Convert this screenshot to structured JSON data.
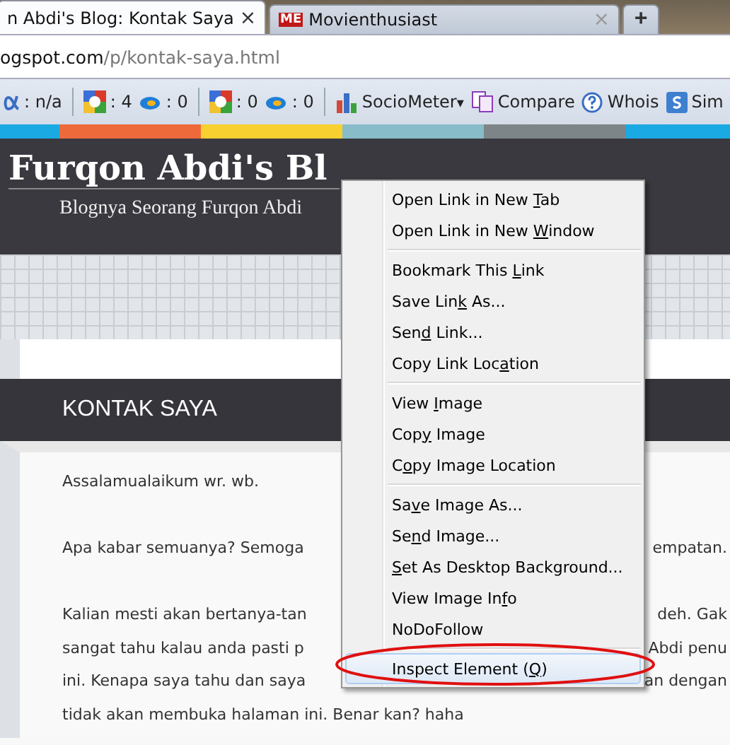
{
  "tabs": [
    {
      "title": "n Abdi's Blog: Kontak Saya",
      "selected": true,
      "close": "×"
    },
    {
      "title": "Movienthusiast",
      "selected": false,
      "close": "×",
      "favicon": "ME"
    }
  ],
  "new_tab": "+",
  "address": {
    "host": "ogspot.com",
    "path": "/p/kontak-saya.html"
  },
  "toolbar": [
    {
      "kind": "alpha",
      "text": ": n/a"
    },
    {
      "kind": "sep"
    },
    {
      "kind": "google",
      "text": ": 4"
    },
    {
      "kind": "bing",
      "text": ": 0"
    },
    {
      "kind": "sep"
    },
    {
      "kind": "google",
      "text": ": 0"
    },
    {
      "kind": "bing",
      "text": ": 0"
    },
    {
      "kind": "sep"
    },
    {
      "kind": "chart",
      "text": "SocioMeter",
      "caret": "▾"
    },
    {
      "kind": "compare",
      "text": "Compare"
    },
    {
      "kind": "whois",
      "text": "Whois"
    },
    {
      "kind": "sim",
      "text": "Sim"
    }
  ],
  "blog": {
    "title": "Furqon Abdi's Bl",
    "subtitle": "Blognya Seorang Furqon Abdi",
    "heading": "KONTAK SAYA"
  },
  "lines": [
    {
      "left": "Assalamualaikum wr. wb."
    },
    {
      "left": "Apa kabar semuanya? Semoga",
      "right": "empatan.",
      "gap_before": true
    },
    {
      "left": "Kalian mesti akan bertanya-tan",
      "right": "deh. Gak",
      "gap_before": true
    },
    {
      "left": "sangat tahu kalau anda pasti p",
      "right": "Abdi penu"
    },
    {
      "left": "ini. Kenapa saya tahu dan saya",
      "right": "an dengan"
    },
    {
      "left": "tidak akan membuka halaman ini. Benar kan? haha"
    }
  ],
  "menu": [
    {
      "kind": "item",
      "before": "Open Link in New ",
      "key": "T",
      "after": "ab",
      "highlighted": false
    },
    {
      "kind": "item",
      "before": "Open Link in New ",
      "key": "W",
      "after": "indow",
      "highlighted": false
    },
    {
      "kind": "separator"
    },
    {
      "kind": "item",
      "before": "Bookmark This ",
      "key": "L",
      "after": "ink",
      "highlighted": false
    },
    {
      "kind": "item",
      "before": "Save Lin",
      "key": "k",
      "after": " As...",
      "highlighted": false
    },
    {
      "kind": "item",
      "before": "Sen",
      "key": "d",
      "after": " Link...",
      "highlighted": false
    },
    {
      "kind": "item",
      "before": "Copy Link Loc",
      "key": "a",
      "after": "tion",
      "highlighted": false
    },
    {
      "kind": "separator"
    },
    {
      "kind": "item",
      "before": "View ",
      "key": "I",
      "after": "mage",
      "highlighted": false
    },
    {
      "kind": "item",
      "before": "Cop",
      "key": "y",
      "after": " Image",
      "highlighted": false
    },
    {
      "kind": "item",
      "before": "C",
      "key": "o",
      "after": "py Image Location",
      "highlighted": false
    },
    {
      "kind": "separator"
    },
    {
      "kind": "item",
      "before": "Sa",
      "key": "v",
      "after": "e Image As...",
      "highlighted": false
    },
    {
      "kind": "item",
      "before": "Se",
      "key": "n",
      "after": "d Image...",
      "highlighted": false
    },
    {
      "kind": "item",
      "key": "S",
      "after": "et As Desktop Background...",
      "highlighted": false
    },
    {
      "kind": "item",
      "before": "View Image In",
      "key": "f",
      "after": "o",
      "highlighted": false
    },
    {
      "kind": "item",
      "before": "NoDoFollow",
      "highlighted": false
    },
    {
      "kind": "separator"
    },
    {
      "kind": "item",
      "before": "Inspect Element (",
      "key": "Q",
      "after": ")",
      "highlighted": true
    }
  ]
}
